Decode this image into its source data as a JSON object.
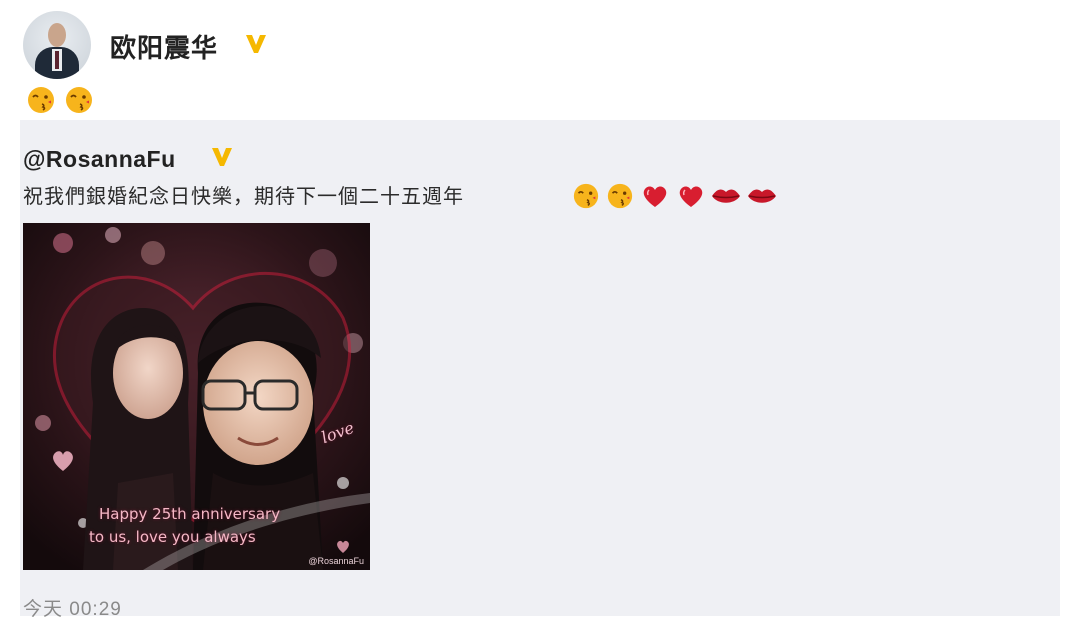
{
  "post": {
    "author": "欧阳震华",
    "verified_badge": "verified-v-badge",
    "content_emojis": [
      "wink-kiss-emoji",
      "wink-kiss-emoji"
    ]
  },
  "repost": {
    "author": "@RosannaFu",
    "verified_badge": "verified-v-badge",
    "text": "祝我們銀婚紀念日快樂，期待下一個二十五週年",
    "trailing_emojis": [
      "wink-kiss-emoji",
      "wink-kiss-emoji",
      "heart-emoji",
      "heart-emoji",
      "lips-emoji",
      "lips-emoji"
    ],
    "image": {
      "caption_line1": "Happy 25th anniversary",
      "caption_line2": "to us, love you always",
      "decor_text": "love",
      "watermark": "@RosannaFu"
    }
  },
  "timestamp": "今天 00:29",
  "colors": {
    "badge": "#f5b800",
    "repost_bg": "#eff0f4",
    "emoji_face": "#f7b41c",
    "heart": "#d81e30"
  }
}
